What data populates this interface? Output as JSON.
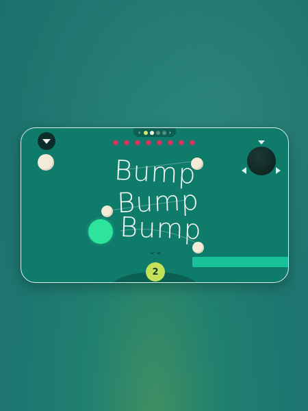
{
  "game": {
    "title_words": [
      "Bump",
      "Bump",
      "Bump"
    ],
    "counter_value": "2",
    "stars_count": 8,
    "level_dots": [
      "done",
      "current",
      "locked",
      "locked"
    ],
    "nav_prev": "‹",
    "nav_next": "›",
    "star_glyph": "✸",
    "down_glyph": "⌄⌄",
    "colors": {
      "screen_bg": "#0f7b6a",
      "star": "#e3305c",
      "player_ball": "#2ee39b",
      "counter_bg": "#c3e25a",
      "platform": "#19c39a"
    },
    "icons": {
      "drop": "drop-triangle-icon",
      "star": "star-burst-icon",
      "prev": "chevron-left-icon",
      "next": "chevron-right-icon"
    }
  }
}
